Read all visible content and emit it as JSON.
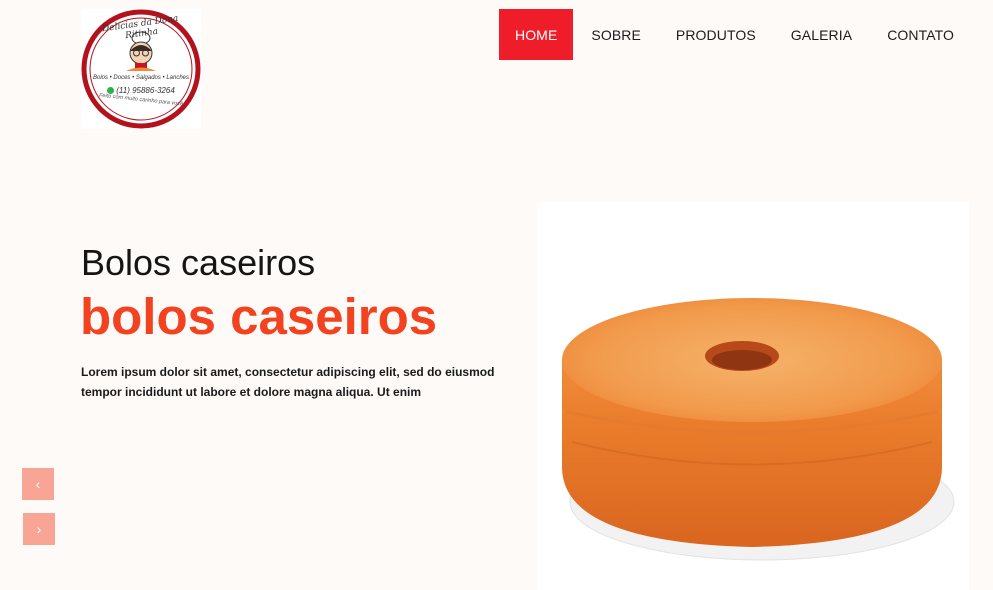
{
  "logo": {
    "brand_top": "Delícias da Dona Ritinha",
    "tagline": "Bolos • Doces • Salgados • Lanches",
    "phone": "(11) 95886-3264",
    "footer": "Feito com muito carinho para você"
  },
  "nav": {
    "items": [
      {
        "label": "HOME",
        "active": true
      },
      {
        "label": "SOBRE",
        "active": false
      },
      {
        "label": "PRODUTOS",
        "active": false
      },
      {
        "label": "GALERIA",
        "active": false
      },
      {
        "label": "CONTATO",
        "active": false
      }
    ]
  },
  "hero": {
    "title": "Bolos caseiros",
    "subtitle": "bolos caseiros",
    "description": "Lorem ipsum dolor sit amet, consectetur adipiscing elit, sed do eiusmod tempor incididunt ut labore et dolore magna aliqua. Ut enim"
  },
  "carousel": {
    "prev_symbol": "‹",
    "next_symbol": "›"
  },
  "colors": {
    "accent_red": "#ef1c2a",
    "subtitle_orange": "#f2421f",
    "carousel_button": "#f9a596",
    "background": "#fdfaf8"
  }
}
